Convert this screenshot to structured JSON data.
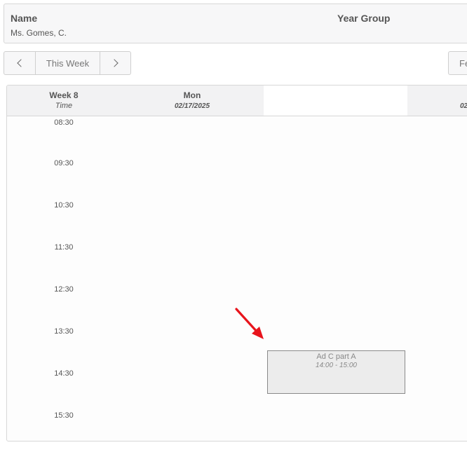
{
  "info": {
    "name_label": "Name",
    "name_value": "Ms. Gomes, C.",
    "year_group_label": "Year Group"
  },
  "nav": {
    "prev_icon": "chevron-left-icon",
    "week_label": "This Week",
    "next_icon": "chevron-right-icon",
    "right_button_label": "Fe"
  },
  "calendar": {
    "week_title": "Week 8",
    "time_column_label": "Time",
    "days": [
      {
        "name": "Mon",
        "date": "02/17/2025"
      }
    ],
    "next_day_date_partial": "02",
    "time_slots": [
      "08:30",
      "09:30",
      "10:30",
      "11:30",
      "12:30",
      "13:30",
      "14:30",
      "15:30"
    ],
    "event": {
      "title": "Ad C part A",
      "time": "14:00 - 15:00"
    }
  },
  "annotation": {
    "arrow_color": "#e8141c"
  }
}
